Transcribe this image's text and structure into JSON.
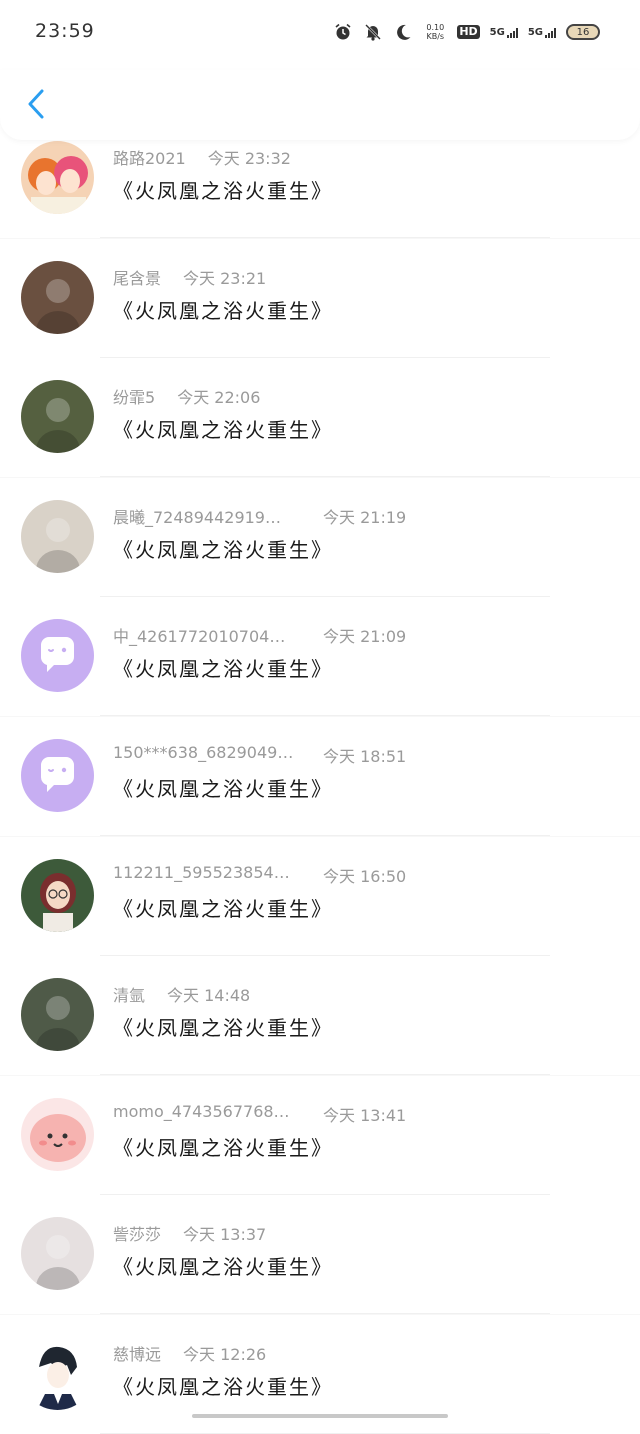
{
  "status_bar": {
    "time": "23:59",
    "net_speed_value": "0.10",
    "net_speed_unit": "KB/s",
    "hd_label": "HD",
    "signal1_label": "5G",
    "signal2_label": "5G",
    "battery_level": "16"
  },
  "comments": [
    {
      "name": "路路2021",
      "time": "今天 23:32",
      "message": "《火凤凰之浴火重生》",
      "avatar": "anime-girls-avatar",
      "bg": "#e8856a"
    },
    {
      "name": "尾含景",
      "time": "今天 23:21",
      "message": "《火凤凰之浴火重生》",
      "avatar": "photo-avatar",
      "bg": "#6a5040"
    },
    {
      "name": "纷霏5",
      "time": "今天 22:06",
      "message": "《火凤凰之浴火重生》",
      "avatar": "photo-avatar",
      "bg": "#556040"
    },
    {
      "name": "晨曦_72489442919…",
      "time": "今天 21:19",
      "message": "《火凤凰之浴火重生》",
      "avatar": "photo-avatar",
      "bg": "#d9d2c8"
    },
    {
      "name": "中_4261772010704…",
      "time": "今天 21:09",
      "message": "《火凤凰之浴火重生》",
      "avatar": "default-chat-avatar",
      "bg": "#c7aef2"
    },
    {
      "name": "150***638_6829049…",
      "time": "今天 18:51",
      "message": "《火凤凰之浴火重生》",
      "avatar": "default-chat-avatar",
      "bg": "#c7aef2"
    },
    {
      "name": "112211_595523854…",
      "time": "今天 16:50",
      "message": "《火凤凰之浴火重生》",
      "avatar": "illustrated-girl-avatar",
      "bg": "#3d5a3a"
    },
    {
      "name": "清氩",
      "time": "今天 14:48",
      "message": "《火凤凰之浴火重生》",
      "avatar": "photo-avatar",
      "bg": "#4f5a48"
    },
    {
      "name": "momo_47435677681…",
      "time": "今天 13:41",
      "message": "《火凤凰之浴火重生》",
      "avatar": "cute-pink-avatar",
      "bg": "#f6b3b0"
    },
    {
      "name": "訾莎莎",
      "time": "今天 13:37",
      "message": "《火凤凰之浴火重生》",
      "avatar": "photo-avatar",
      "bg": "#e6e0e0"
    },
    {
      "name": "慈博远",
      "time": "今天 12:26",
      "message": "《火凤凰之浴火重生》",
      "avatar": "illustrated-boy-avatar",
      "bg": "#ffffff"
    }
  ]
}
